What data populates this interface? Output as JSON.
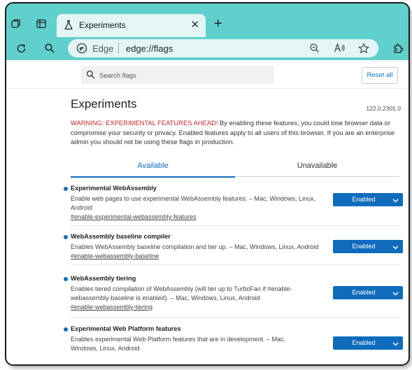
{
  "browser": {
    "tab_title": "Experiments",
    "brand_label": "Edge",
    "url": "edge://flags"
  },
  "search": {
    "placeholder": "Search flags",
    "reset_label": "Reset all"
  },
  "page": {
    "title": "Experiments",
    "version": "122.0.2301.0",
    "warning_strong": "WARNING: EXPERIMENTAL FEATURES AHEAD!",
    "warning_rest": " By enabling these features, you could lose browser data or compromise your security or privacy. Enabled features apply to all users of this browser. If you are an enterprise admin you should not be using these flags in production.",
    "tabs": [
      "Available",
      "Unavailable"
    ]
  },
  "flags": [
    {
      "name": "Experimental WebAssembly",
      "description": "Enable web pages to use experimental WebAssembly features. – Mac, Windows, Linux, Android",
      "link": "#enable-experimental-webassembly-features",
      "state": "Enabled"
    },
    {
      "name": "WebAssembly baseline compiler",
      "description": "Enables WebAssembly baseline compilation and tier up. – Mac, Windows, Linux, Android",
      "link": "#enable-webassembly-baseline",
      "state": "Enabled"
    },
    {
      "name": "WebAssembly tiering",
      "description": "Enables tiered compilation of WebAssembly (will tier up to TurboFan if #enable-webassembly-baseline is enabled). – Mac, Windows, Linux, Android",
      "link": "#enable-webassembly-tiering",
      "state": "Enabled"
    },
    {
      "name": "Experimental Web Platform features",
      "description": "Enables experimental Web Platform features that are in development. – Mac, Windows, Linux, Android",
      "state": "Enabled"
    }
  ],
  "colors": {
    "chrome": "#5fd0cc",
    "accent": "#0f6cbd",
    "warning": "#c4262e"
  },
  "icons": [
    "collections-icon",
    "tab-actions-icon",
    "flask-icon",
    "close-icon",
    "new-tab-icon",
    "refresh-icon",
    "search-icon",
    "edge-logo-icon",
    "zoom-out-icon",
    "read-aloud-icon",
    "favorite-star-icon",
    "extensions-icon",
    "chevron-down-icon"
  ]
}
